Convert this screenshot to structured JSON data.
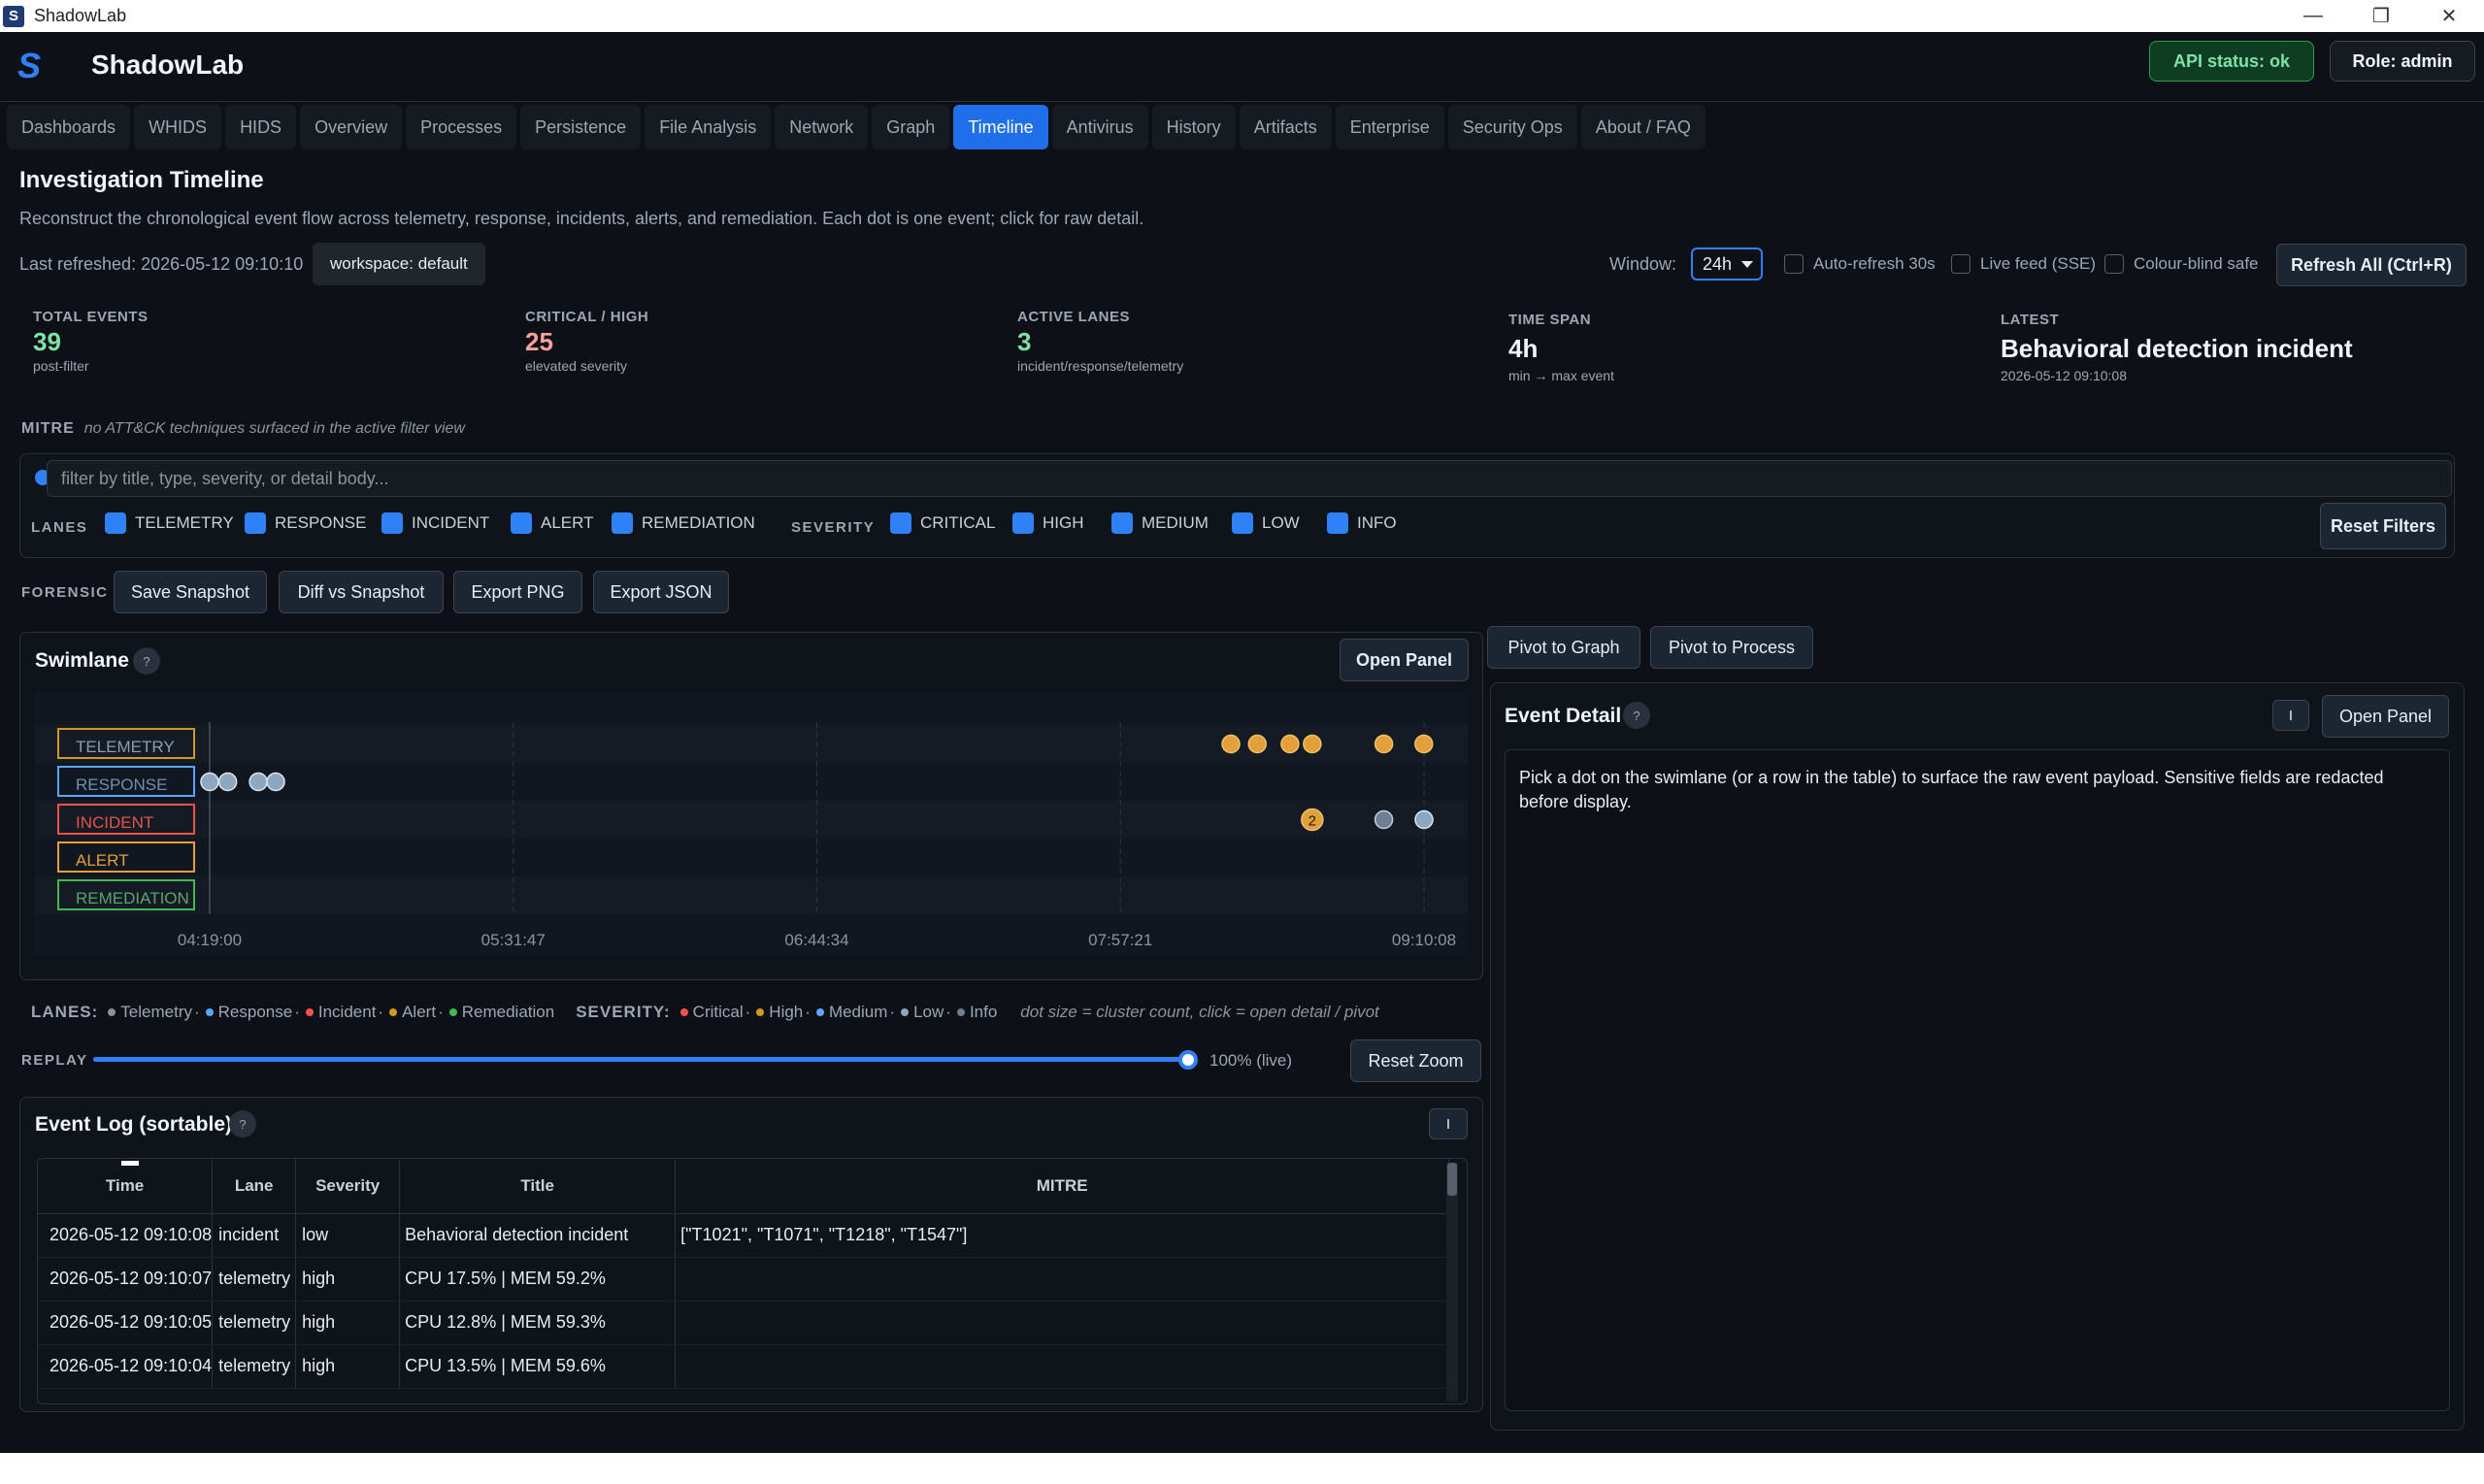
{
  "window": {
    "title": "ShadowLab",
    "app_icon": "S",
    "minimize": "—",
    "maximize": "❐",
    "close": "✕"
  },
  "header": {
    "logo": "S",
    "brand": "ShadowLab",
    "api_status": "API status: ok",
    "role": "Role: admin"
  },
  "tabs": [
    {
      "label": "Dashboards"
    },
    {
      "label": "WHIDS"
    },
    {
      "label": "HIDS"
    },
    {
      "label": "Overview"
    },
    {
      "label": "Processes"
    },
    {
      "label": "Persistence"
    },
    {
      "label": "File Analysis"
    },
    {
      "label": "Network"
    },
    {
      "label": "Graph"
    },
    {
      "label": "Timeline",
      "active": true
    },
    {
      "label": "Antivirus"
    },
    {
      "label": "History"
    },
    {
      "label": "Artifacts"
    },
    {
      "label": "Enterprise"
    },
    {
      "label": "Security Ops"
    },
    {
      "label": "About / FAQ"
    }
  ],
  "page": {
    "title": "Investigation Timeline",
    "description": "Reconstruct the chronological event flow across telemetry, response, incidents, alerts, and remediation. Each dot is one event; click for raw detail.",
    "last_refreshed": "Last refreshed: 2026-05-12 09:10:10",
    "workspace": "workspace: default"
  },
  "controls": {
    "window_label": "Window:",
    "window_value": "24h",
    "auto_refresh": "Auto-refresh 30s",
    "live_feed": "Live feed (SSE)",
    "colour_blind": "Colour-blind safe",
    "refresh_all": "Refresh All (Ctrl+R)"
  },
  "stats": {
    "total": {
      "label": "TOTAL EVENTS",
      "value": "39",
      "sub": "post-filter",
      "color": "#7ee2a8"
    },
    "critical": {
      "label": "CRITICAL / HIGH",
      "value": "25",
      "sub": "elevated severity",
      "color": "#ffa198"
    },
    "lanes": {
      "label": "ACTIVE LANES",
      "value": "3",
      "sub": "incident/response/telemetry",
      "color": "#7ee2a8"
    },
    "span": {
      "label": "TIME SPAN",
      "value": "4h",
      "sub": "min → max event",
      "color": "#f0f6fc"
    },
    "latest": {
      "label": "LATEST",
      "value": "Behavioral detection incident",
      "sub": "2026-05-12 09:10:08",
      "color": "#f0f6fc"
    }
  },
  "mitre": {
    "label": "MITRE",
    "text": "no ATT&CK techniques surfaced in the active filter view"
  },
  "filters": {
    "search_placeholder": "filter by title, type, severity, or detail body...",
    "lanes_label": "LANES",
    "lanes": [
      "TELEMETRY",
      "RESPONSE",
      "INCIDENT",
      "ALERT",
      "REMEDIATION"
    ],
    "severity_label": "SEVERITY",
    "severities": [
      "CRITICAL",
      "HIGH",
      "MEDIUM",
      "LOW",
      "INFO"
    ],
    "reset": "Reset Filters"
  },
  "forensic": {
    "label": "FORENSIC",
    "buttons": [
      "Save Snapshot",
      "Diff vs Snapshot",
      "Export PNG",
      "Export JSON"
    ]
  },
  "swimlane": {
    "title": "Swimlane",
    "help": "?",
    "open_panel": "Open Panel",
    "lanes": [
      {
        "name": "TELEMETRY",
        "color": "#d29922",
        "text": "#8b9bb0"
      },
      {
        "name": "RESPONSE",
        "color": "#58a6ff",
        "text": "#6e8fb5"
      },
      {
        "name": "INCIDENT",
        "color": "#f85149",
        "text": "#e5534b"
      },
      {
        "name": "ALERT",
        "color": "#e3a03a",
        "text": "#e3a03a"
      },
      {
        "name": "REMEDIATION",
        "color": "#3fb950",
        "text": "#5aa36a"
      }
    ],
    "ticks": [
      "04:19:00",
      "05:31:47",
      "06:44:34",
      "07:57:21",
      "09:10:08"
    ],
    "cluster_label": "2",
    "dot_colors": {
      "high": "#e3a03a",
      "low": "#8fa6bf",
      "info": "#6e7f94"
    }
  },
  "chart_data": {
    "type": "scatter",
    "title": "Swimlane",
    "x_axis": "time",
    "xlim": [
      "04:19:00",
      "09:10:08"
    ],
    "categories": [
      "TELEMETRY",
      "RESPONSE",
      "INCIDENT",
      "ALERT",
      "REMEDIATION"
    ],
    "series": [
      {
        "lane": "TELEMETRY",
        "severity": "high",
        "points": [
          {
            "t": "08:23:50",
            "count": 1
          },
          {
            "t": "08:30:10",
            "count": 1
          },
          {
            "t": "08:38:00",
            "count": 1
          },
          {
            "t": "08:43:20",
            "count": 1
          },
          {
            "t": "09:00:30",
            "count": 1
          },
          {
            "t": "09:10:05",
            "count": 1
          }
        ]
      },
      {
        "lane": "RESPONSE",
        "severity": "low",
        "points": [
          {
            "t": "04:19:00",
            "count": 1
          },
          {
            "t": "04:23:20",
            "count": 1
          },
          {
            "t": "04:30:40",
            "count": 1
          },
          {
            "t": "04:34:50",
            "count": 1
          }
        ]
      },
      {
        "lane": "INCIDENT",
        "severity": "high",
        "points": [
          {
            "t": "08:43:20",
            "count": 2
          }
        ]
      },
      {
        "lane": "INCIDENT",
        "severity": "info",
        "points": [
          {
            "t": "09:00:30",
            "count": 1
          }
        ]
      },
      {
        "lane": "INCIDENT",
        "severity": "low",
        "points": [
          {
            "t": "09:10:08",
            "count": 1
          }
        ]
      }
    ]
  },
  "legend": {
    "lanes_label": "LANES:",
    "lanes": [
      {
        "name": "Telemetry",
        "color": "#8b949e"
      },
      {
        "name": "Response",
        "color": "#58a6ff"
      },
      {
        "name": "Incident",
        "color": "#f85149"
      },
      {
        "name": "Alert",
        "color": "#d29922"
      },
      {
        "name": "Remediation",
        "color": "#3fb950"
      }
    ],
    "severity_label": "SEVERITY:",
    "severities": [
      {
        "name": "Critical",
        "color": "#f85149"
      },
      {
        "name": "High",
        "color": "#d29922"
      },
      {
        "name": "Medium",
        "color": "#58a6ff"
      },
      {
        "name": "Low",
        "color": "#8fa6bf"
      },
      {
        "name": "Info",
        "color": "#6e7f94"
      }
    ],
    "note": "dot size = cluster count, click = open detail / pivot"
  },
  "replay": {
    "label": "REPLAY",
    "value": "100% (live)",
    "fraction": 1.0,
    "reset_zoom": "Reset Zoom"
  },
  "event_log": {
    "title": "Event Log (sortable)",
    "help": "?",
    "collapse": "I",
    "columns": [
      "Time",
      "Lane",
      "Severity",
      "Title",
      "MITRE"
    ],
    "rows": [
      [
        "2026-05-12 09:10:08",
        "incident",
        "low",
        "Behavioral detection incident",
        "[\"T1021\", \"T1071\", \"T1218\", \"T1547\"]"
      ],
      [
        "2026-05-12 09:10:07",
        "telemetry",
        "high",
        "CPU 17.5% | MEM 59.2%",
        ""
      ],
      [
        "2026-05-12 09:10:05",
        "telemetry",
        "high",
        "CPU 12.8% | MEM 59.3%",
        ""
      ],
      [
        "2026-05-12 09:10:04",
        "telemetry",
        "high",
        "CPU 13.5% | MEM 59.6%",
        ""
      ]
    ]
  },
  "pivots": [
    "Pivot to Graph",
    "Pivot to Process"
  ],
  "event_detail": {
    "title": "Event Detail",
    "help": "?",
    "collapse": "I",
    "open_panel": "Open Panel",
    "body": "Pick a dot on the swimlane (or a row in the table) to surface the raw event payload. Sensitive fields are redacted before display."
  }
}
